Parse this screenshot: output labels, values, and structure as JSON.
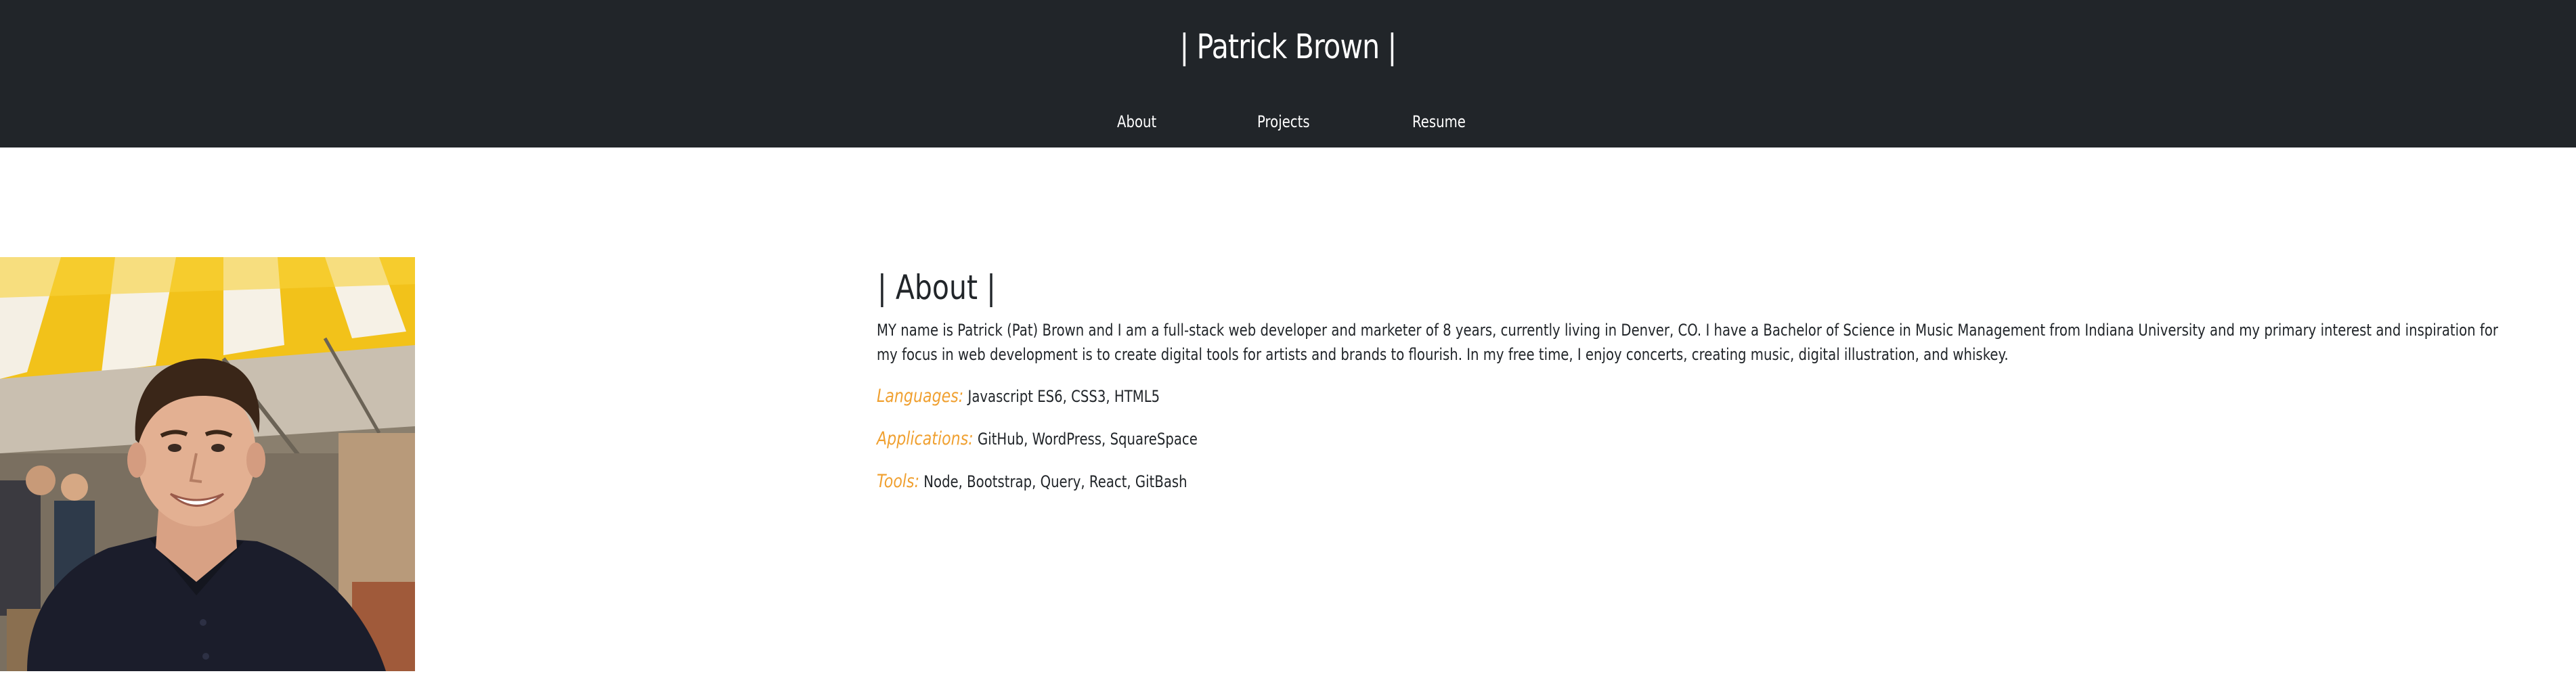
{
  "header": {
    "title": "| Patrick Brown |",
    "nav": [
      {
        "label": "About"
      },
      {
        "label": "Projects"
      },
      {
        "label": "Resume"
      }
    ]
  },
  "about": {
    "heading": "| About |",
    "text": "MY name is Patrick (Pat) Brown and I am a full-stack web developer and marketer of 8 years, currently living in Denver, CO. I have a Bachelor of Science in Music Management from Indiana University and my primary interest and inspiration for my focus in web development is to create digital tools for artists and brands to flourish. In my free time, I enjoy concerts, creating music, digital illustration, and whiskey.",
    "skills": [
      {
        "label": "Languages:",
        "value": "Javascript ES6, CSS3, HTML5"
      },
      {
        "label": "Applications:",
        "value": "GitHub, WordPress, SquareSpace"
      },
      {
        "label": "Tools:",
        "value": "Node, Bootstrap, Query, React, GitBash"
      }
    ]
  },
  "colors": {
    "header_bg": "#212529",
    "accent": "#f0a030",
    "text": "#212529"
  }
}
